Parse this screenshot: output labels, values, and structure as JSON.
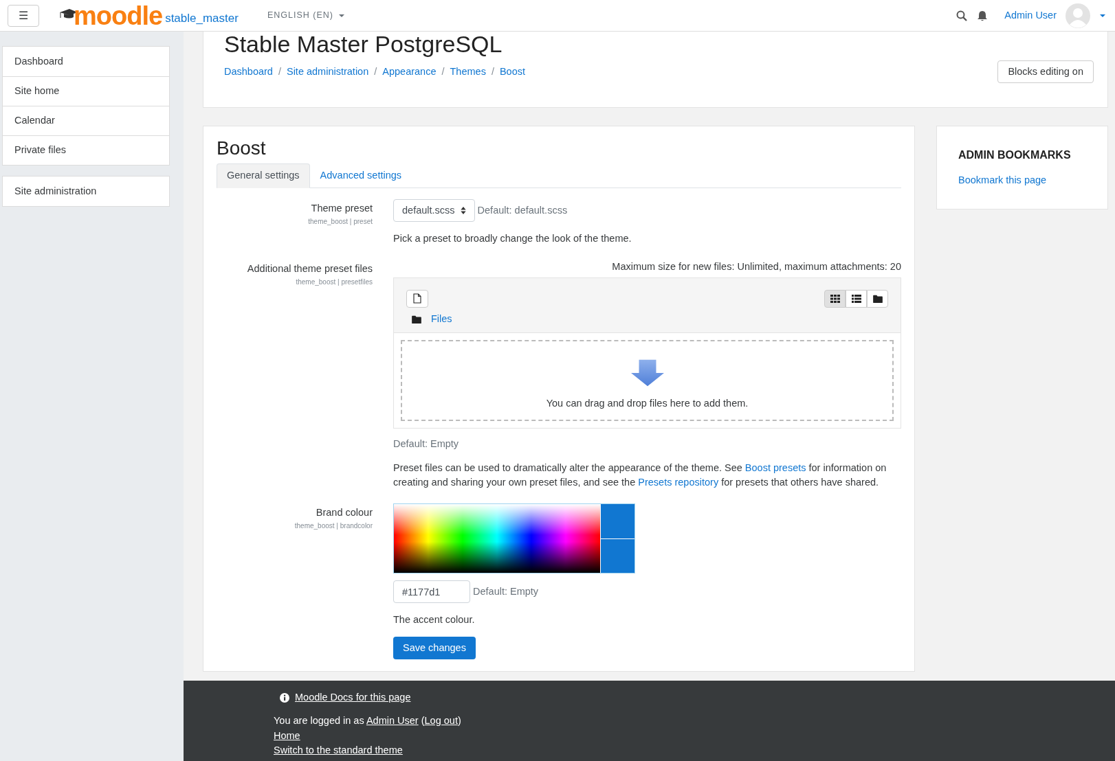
{
  "navbar": {
    "menu_icon": "☰",
    "logo": "moodle",
    "site_name": "stable_master",
    "language": "ENGLISH (EN)",
    "user_name": "Admin User"
  },
  "sidebar": {
    "groups": [
      [
        "Dashboard",
        "Site home",
        "Calendar",
        "Private files"
      ],
      [
        "Site administration"
      ]
    ]
  },
  "header": {
    "title": "Stable Master PostgreSQL",
    "breadcrumb_separator": "/",
    "breadcrumbs": [
      "Dashboard",
      "Site administration",
      "Appearance",
      "Themes",
      "Boost"
    ],
    "button": "Blocks editing on"
  },
  "settings": {
    "title": "Boost",
    "tabs": [
      {
        "label": "General settings",
        "selected": true
      },
      {
        "label": "Advanced settings",
        "selected": false
      }
    ],
    "fields": [
      {
        "kind": "select",
        "label": "Theme preset",
        "key": "theme_boost | preset",
        "value": "default.scss",
        "default": "Default: default.scss",
        "description": [
          {
            "text": "Pick a preset to broadly change the look of the theme."
          }
        ]
      },
      {
        "kind": "files",
        "label": "Additional theme preset files",
        "key": "theme_boost | presetfiles",
        "limits": "Maximum size for new files: Unlimited, maximum attachments: 20",
        "folder": "Files",
        "views": [
          {
            "selected": true
          },
          {
            "selected": false
          },
          {
            "selected": false
          }
        ],
        "drop_text": "You can drag and drop files here to add them.",
        "default": "Default: Empty",
        "description": [
          {
            "text": "Preset files can be used to dramatically alter the appearance of the theme. See "
          },
          {
            "link": "Boost presets"
          },
          {
            "text": " for information on creating and sharing your own preset files, and see the "
          },
          {
            "link": "Presets repository"
          },
          {
            "text": " for presets that others have shared."
          }
        ]
      },
      {
        "kind": "color",
        "label": "Brand colour",
        "key": "theme_boost | brandcolor",
        "value": "#1177d1",
        "default": "Default: Empty",
        "description": [
          {
            "text": "The accent colour."
          }
        ]
      }
    ],
    "save": "Save changes"
  },
  "bookmarks": {
    "title": "ADMIN BOOKMARKS",
    "link": "Bookmark this page"
  },
  "footer": {
    "docs_link": "Moodle Docs for this page",
    "login": [
      {
        "text": "You are logged in as "
      },
      {
        "link": "Admin User"
      },
      {
        "text": " ("
      },
      {
        "link": "Log out"
      },
      {
        "text": ")"
      }
    ],
    "links": [
      "Home",
      "Switch to the standard theme"
    ]
  }
}
